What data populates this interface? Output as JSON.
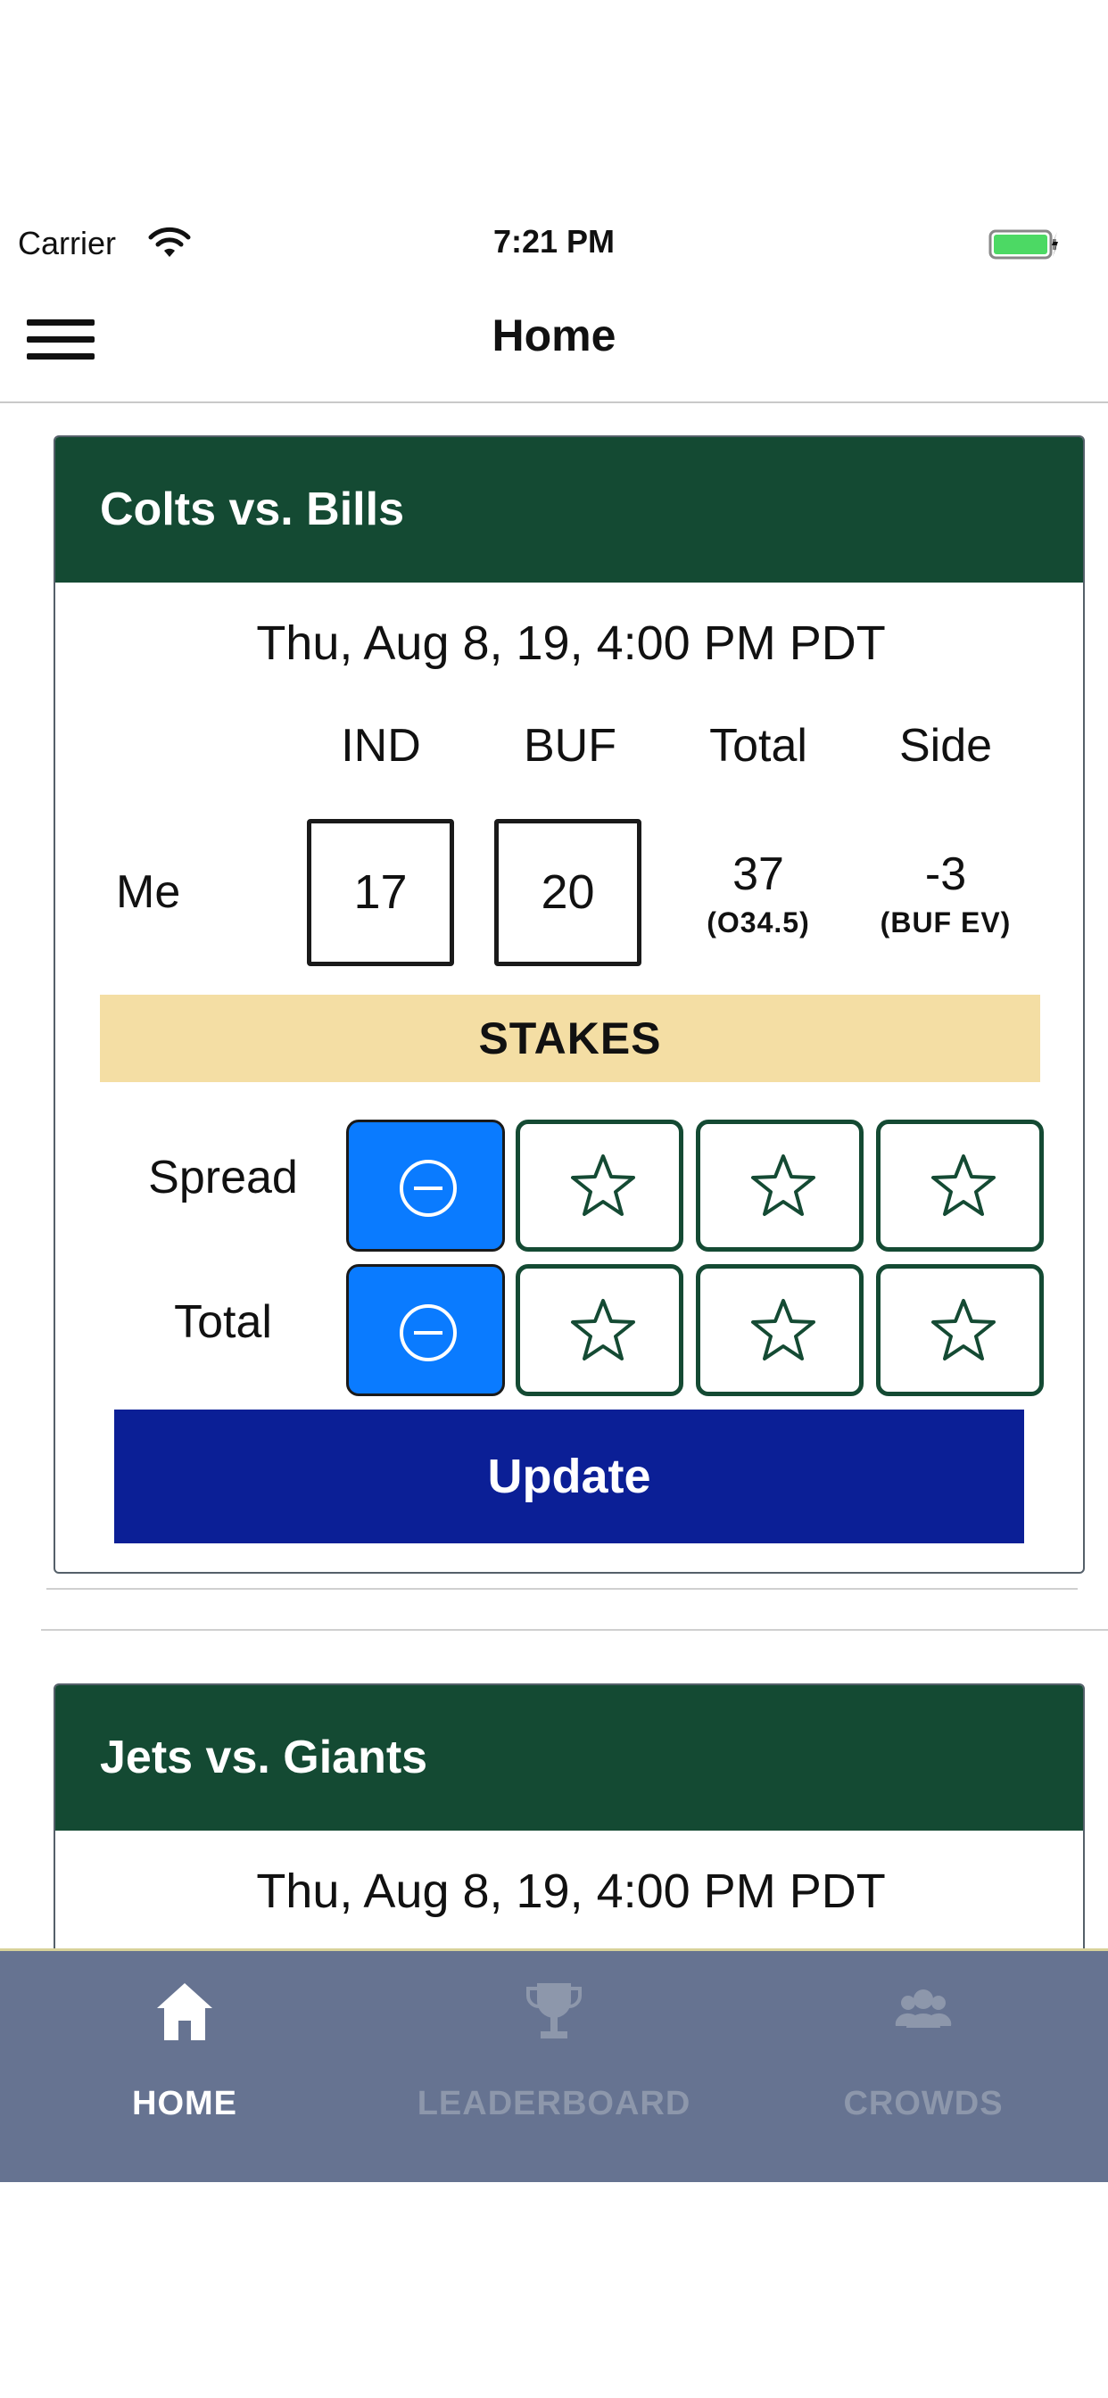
{
  "status_bar": {
    "carrier": "Carrier",
    "time": "7:21 PM"
  },
  "nav": {
    "title": "Home"
  },
  "games": [
    {
      "title": "Colts vs. Bills",
      "datetime": "Thu, Aug 8, 19, 4:00 PM PDT",
      "columns": [
        "IND",
        "BUF",
        "Total",
        "Side"
      ],
      "row_label": "Me",
      "home_score": "17",
      "away_score": "20",
      "total": "37",
      "total_note": "(O34.5)",
      "side": "-3",
      "side_note": "(BUF EV)",
      "stakes_label": "STAKES",
      "stake_rows": [
        "Spread",
        "Total"
      ],
      "update_label": "Update"
    },
    {
      "title": "Jets vs. Giants",
      "datetime": "Thu, Aug 8, 19, 4:00 PM PDT"
    }
  ],
  "tabs": [
    {
      "label": "HOME",
      "icon": "home-icon",
      "active": true
    },
    {
      "label": "LEADERBOARD",
      "icon": "trophy-icon",
      "active": false
    },
    {
      "label": "CROWDS",
      "icon": "people-icon",
      "active": false
    }
  ],
  "colors": {
    "header_green": "#144a33",
    "stakes_yellow": "#f4dea4",
    "minus_blue": "#0a7bff",
    "update_navy": "#0b1f96",
    "tab_bar": "#667391"
  }
}
